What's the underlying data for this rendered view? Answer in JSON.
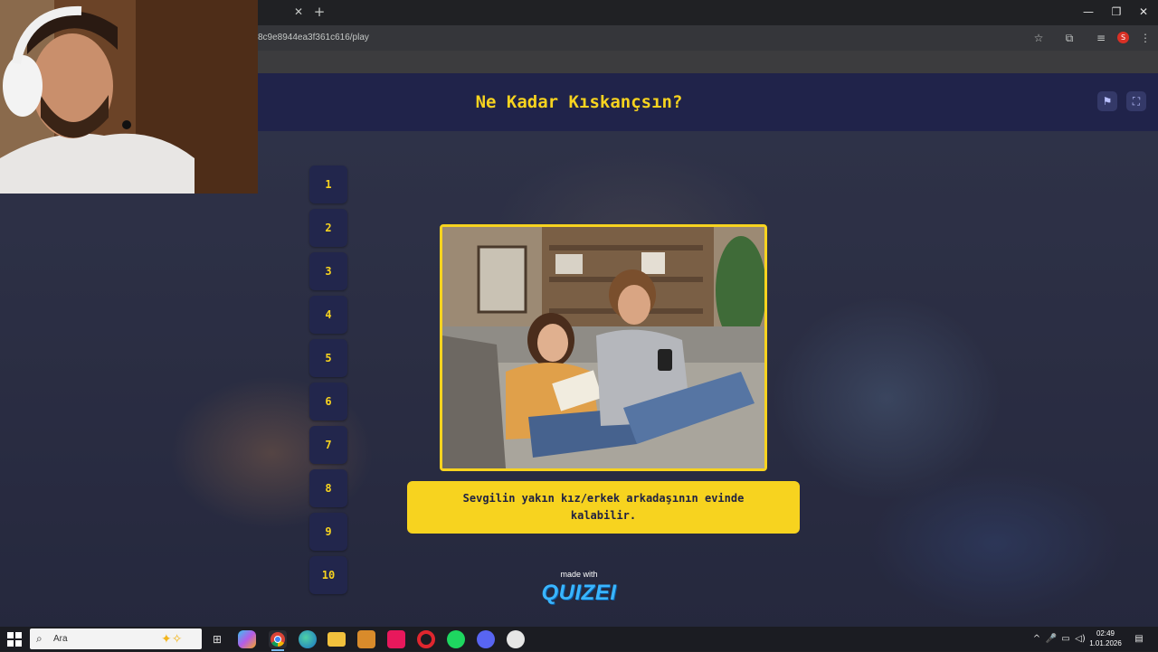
{
  "browser": {
    "url_text": "8c9e8944ea3f361c616/play",
    "tab_close": "✕",
    "new_tab": "+",
    "window": {
      "minimize": "—",
      "restore": "❐",
      "close": "✕"
    },
    "profile_initial": "S"
  },
  "quiz": {
    "title": "Ne Kadar Kıskançsın?",
    "question_numbers": [
      "1",
      "2",
      "3",
      "4",
      "5",
      "6",
      "7",
      "8",
      "9",
      "10"
    ],
    "statement_line1": "Sevgilin yakın kız/erkek arkadaşının evinde",
    "statement_line2": "kalabilir.",
    "made_with": "made with",
    "brand": "QUIZEI",
    "buttons": {
      "report_icon": "flag-icon",
      "fullscreen_icon": "fullscreen-icon"
    }
  },
  "taskbar": {
    "search_placeholder": "Ara",
    "time": "02:49",
    "date": "1.01.2026",
    "apps": [
      "task-view",
      "copilot",
      "chrome",
      "edge",
      "file-explorer",
      "media-player",
      "tiktok",
      "opera",
      "spotify",
      "discord",
      "steam"
    ]
  },
  "colors": {
    "accent_yellow": "#f7d31f",
    "header_navy": "#20234a",
    "button_navy": "#22264c",
    "brand_blue": "#39b5ff"
  }
}
